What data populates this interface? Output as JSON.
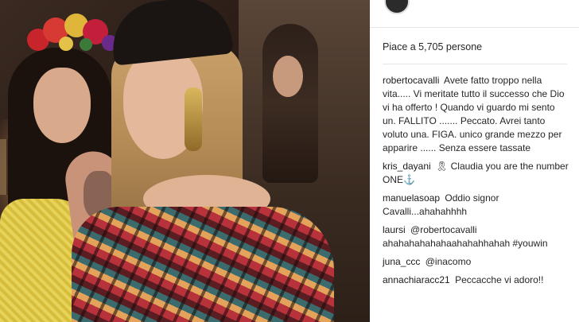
{
  "post": {
    "header_username": "",
    "likes_text": "Piace a 5,705 persone"
  },
  "comments": [
    {
      "user": "robertocavalli",
      "text": "Avete fatto troppo nella vita..... Vi meritate tutto il successo che Dio vi ha offerto ! Quando vi guardo mi sento un. FALLITO ....... Peccato. Avrei tanto voluto una. FIGA. unico grande mezzo per apparire ...... Senza essere tassate"
    },
    {
      "user": "kris_dayani",
      "text": "🎗 Claudia you are the number ONE⚓"
    },
    {
      "user": "manuelasoap",
      "text": "Oddio signor Cavalli...ahahahhhh"
    },
    {
      "user": "laursi",
      "text": "@robertocavalli ahahahahahahaahahahhahah #youwin"
    },
    {
      "user": "juna_ccc",
      "text": "@inacomo"
    },
    {
      "user": "annachiaracc21",
      "text": "Peccacche vi adoro!!"
    }
  ],
  "colors": {
    "text": "#262626",
    "divider": "#e6e6e6"
  }
}
